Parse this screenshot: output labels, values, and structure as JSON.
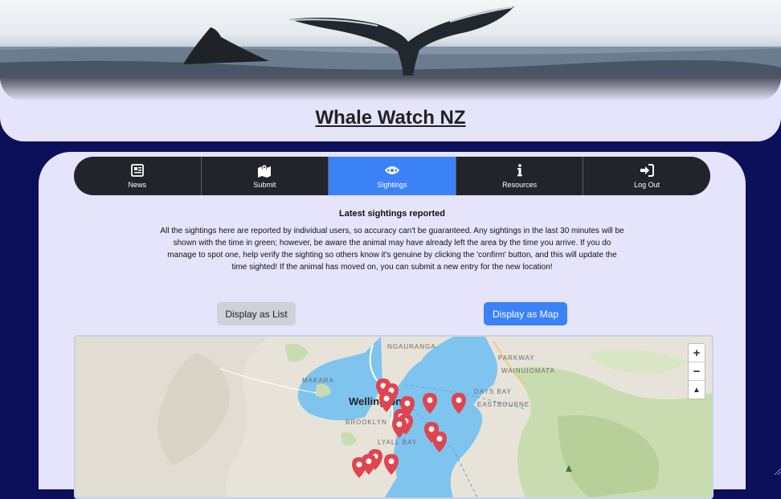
{
  "site": {
    "title": "Whale Watch NZ"
  },
  "nav": {
    "items": [
      {
        "label": "News",
        "icon": "newspaper-icon"
      },
      {
        "label": "Submit",
        "icon": "map-marker-icon"
      },
      {
        "label": "Sightings",
        "icon": "eye-icon",
        "active": true
      },
      {
        "label": "Resources",
        "icon": "info-icon"
      },
      {
        "label": "Log Out",
        "icon": "sign-in-icon"
      }
    ]
  },
  "sightings": {
    "heading": "Latest sightings reported",
    "intro": "All the sightings here are reported by individual users, so accuracy can't be guaranteed. Any sightings in the last 30 minutes will be shown with the time in green; however, be aware the animal may have already left the area by the time you arrive. If you do manage to spot one, help verify the sighting so others know it's genuine by clicking the 'confirm' button, and this will update the time sighted! If the animal has moved on, you can submit a new entry for the new location!",
    "list_button": "Display as List",
    "map_button": "Display as Map"
  },
  "map": {
    "labels": {
      "ngauranga": "NGAURANGA",
      "makara": "MAKARA",
      "wellington": "Wellington",
      "brooklyn": "BROOKLYN",
      "lyall_bay": "LYALL BAY",
      "parkway": "PARKWAY",
      "wainuiomata": "WAINUIOMATA",
      "days_bay": "DAYS BAY",
      "eastbourne": "EASTBOURNE"
    },
    "zoom_in": "+",
    "zoom_out": "−",
    "reset": "▲",
    "marker_count": 18,
    "colors": {
      "water": "#7fc3ef",
      "land": "#e8e3d8",
      "park": "#c9dcb0",
      "marker": "#e0454f"
    }
  },
  "colors": {
    "accent": "#3b82f6",
    "nav_bg": "#21252b",
    "page_bg": "#0c0f5a",
    "card_bg": "#e6e4fb"
  }
}
